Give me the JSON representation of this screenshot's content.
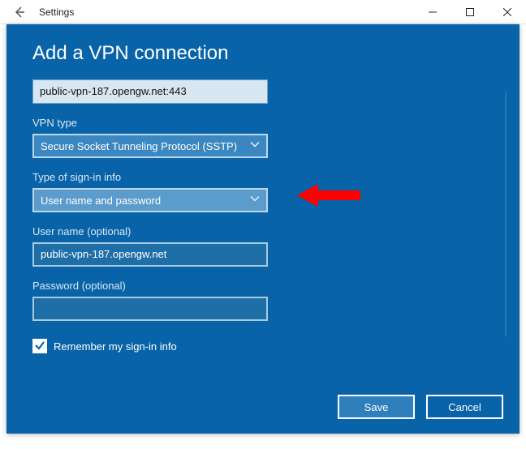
{
  "titlebar": {
    "title": "Settings"
  },
  "panel": {
    "heading": "Add a VPN connection",
    "server_name": "public-vpn-187.opengw.net:443",
    "vpn_type_label": "VPN type",
    "vpn_type_value": "Secure Socket Tunneling Protocol (SSTP)",
    "signin_type_label": "Type of sign-in info",
    "signin_type_value": "User name and password",
    "username_label": "User name (optional)",
    "username_value": "public-vpn-187.opengw.net",
    "password_label": "Password (optional)",
    "password_value": "",
    "remember_label": "Remember my sign-in info",
    "remember_checked": true
  },
  "buttons": {
    "save": "Save",
    "cancel": "Cancel"
  }
}
